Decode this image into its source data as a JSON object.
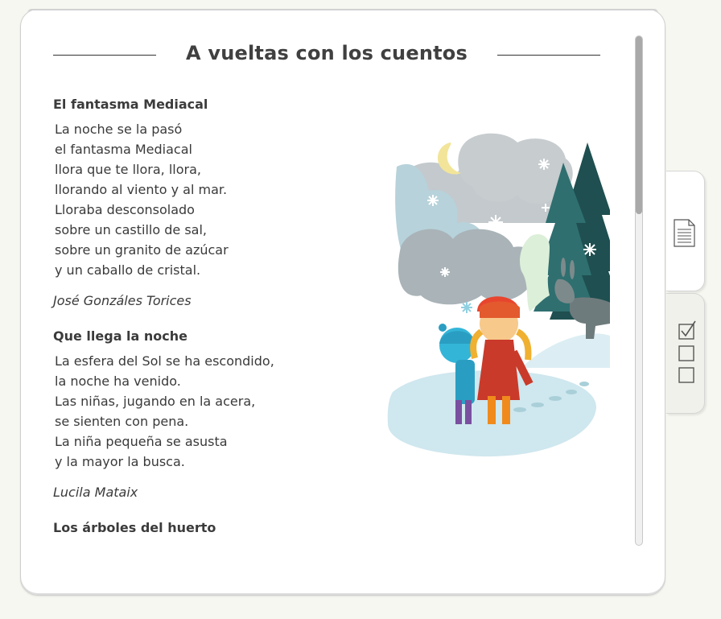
{
  "page": {
    "title": "A vueltas con los cuentos"
  },
  "poems": [
    {
      "title": "El fantasma Mediacal",
      "lines": [
        "La noche se la pasó",
        "el fantasma Mediacal",
        "llora que te llora, llora,",
        "llorando al viento y al mar.",
        "Lloraba desconsolado",
        "sobre un castillo de sal,",
        "sobre un granito de azúcar",
        "y un caballo de cristal."
      ],
      "author": "José Gonzáles Torices"
    },
    {
      "title": "Que llega la noche",
      "lines": [
        "La esfera del Sol se ha escondido,",
        "la noche ha venido.",
        "Las niñas, jugando en la acera,",
        "se sienten con pena.",
        "La niña pequeña se asusta",
        "y la mayor la busca."
      ],
      "author": "Lucila Mataix"
    },
    {
      "title": "Los árboles del huerto"
    }
  ],
  "side_tabs": [
    {
      "icon": "document-icon"
    },
    {
      "icon": "checklist-icon"
    }
  ],
  "scroll": {
    "position_fraction": 0.0,
    "visible_fraction": 0.35
  },
  "colors": {
    "background": "#f7f7f1",
    "text": "#3a3a3a",
    "card": "#ffffff"
  }
}
